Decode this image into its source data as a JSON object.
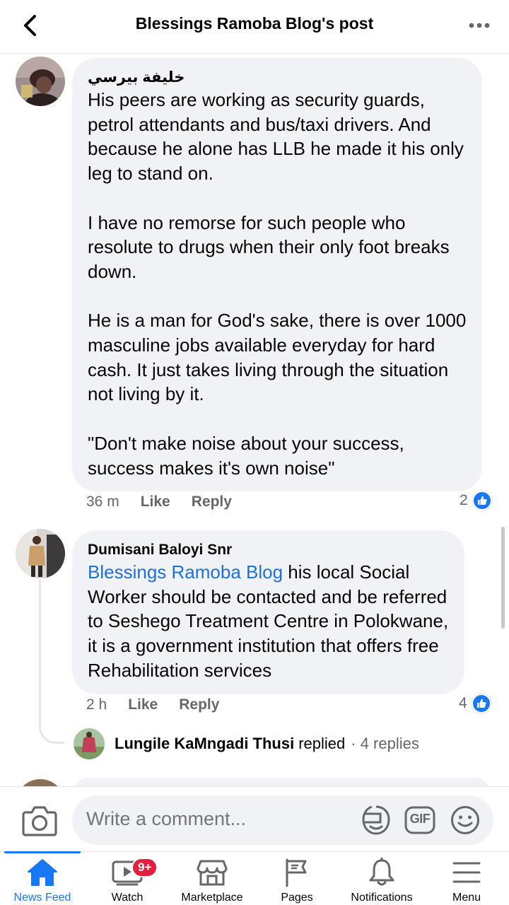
{
  "header": {
    "title": "Blessings Ramoba Blog's post"
  },
  "comments": [
    {
      "author": "خليفة بيرسي",
      "text": "His peers are working as security guards, petrol attendants and bus/taxi drivers. And because he alone has LLB he made it his only leg to stand on.\n\nI have no remorse for such people who resolute to drugs when their only foot breaks down.\n\nHe is a man for God's sake, there is over 1000 masculine jobs available everyday for hard cash. It just takes living through the situation not living by it.\n\n\"Don't make noise about your success, success makes it's own noise\"",
      "time": "36 m",
      "like_label": "Like",
      "reply_label": "Reply",
      "reaction_count": "2"
    },
    {
      "author": "Dumisani Baloyi Snr",
      "mention": "Blessings Ramoba Blog",
      "text": " his local Social Worker should be contacted and be referred to Seshego Treatment Centre in Polokwane,  it is a government institution that offers free Rehabilitation services",
      "time": "2 h",
      "like_label": "Like",
      "reply_label": "Reply",
      "reaction_count": "4",
      "replies": {
        "name": "Lungile KaMngadi Thusi",
        "action": "replied",
        "count": "· 4 replies"
      }
    }
  ],
  "composer": {
    "placeholder": "Write a comment...",
    "gif_label": "GIF"
  },
  "tabs": [
    {
      "label": "News Feed",
      "icon": "home-icon",
      "active": true
    },
    {
      "label": "Watch",
      "icon": "watch-icon",
      "badge": "9+"
    },
    {
      "label": "Marketplace",
      "icon": "marketplace-icon"
    },
    {
      "label": "Pages",
      "icon": "flag-icon"
    },
    {
      "label": "Notifications",
      "icon": "bell-icon"
    },
    {
      "label": "Menu",
      "icon": "menu-icon"
    }
  ],
  "colors": {
    "accent": "#1877f2",
    "mention": "#216fdb",
    "bubble": "#f0f2f5",
    "muted": "#65676b",
    "badge": "#e41e3f"
  }
}
